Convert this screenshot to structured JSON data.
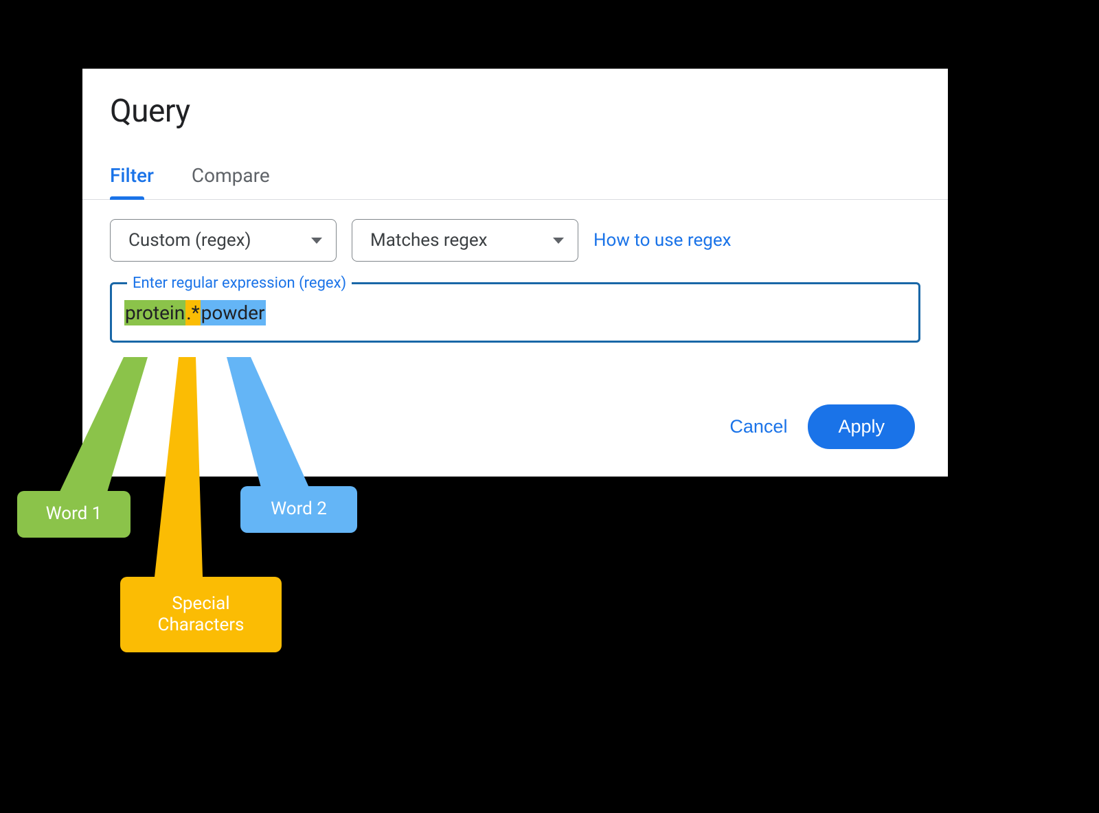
{
  "title": "Query",
  "tabs": {
    "filter": "Filter",
    "compare": "Compare"
  },
  "dropdowns": {
    "type": "Custom (regex)",
    "match": "Matches regex"
  },
  "help_link": "How to use regex",
  "regex_field": {
    "label": "Enter regular expression (regex)",
    "word1": "protein",
    "special": ".*",
    "word2": "powder"
  },
  "buttons": {
    "cancel": "Cancel",
    "apply": "Apply"
  },
  "annotations": {
    "word1": "Word 1",
    "word2": "Word 2",
    "special": "Special\nCharacters"
  },
  "colors": {
    "green": "#8bc34a",
    "orange": "#fbbc04",
    "blue": "#64b5f6",
    "primary": "#1a73e8"
  }
}
